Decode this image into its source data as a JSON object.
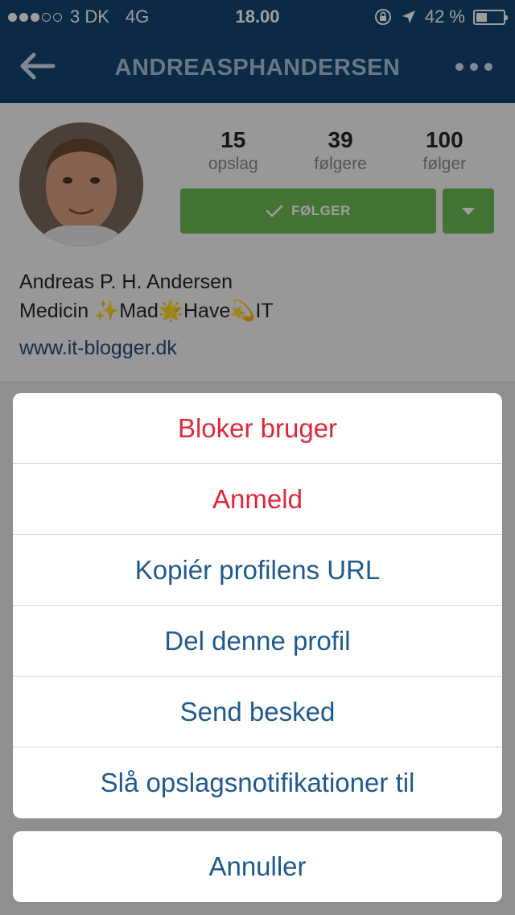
{
  "status_bar": {
    "carrier": "3 DK",
    "network": "4G",
    "time": "18.00",
    "battery": "42 %",
    "battery_level": 0.42
  },
  "nav": {
    "title": "ANDREASPHANDERSEN"
  },
  "profile": {
    "stats": [
      {
        "value": "15",
        "label": "opslag"
      },
      {
        "value": "39",
        "label": "følgere"
      },
      {
        "value": "100",
        "label": "følger"
      }
    ],
    "follow_label": "FØLGER",
    "full_name": "Andreas P. H. Andersen",
    "bio": "Medicin ✨Mad🌟Have💫IT",
    "website": "www.it-blogger.dk"
  },
  "action_sheet": {
    "items": [
      {
        "label": "Bloker bruger"
      },
      {
        "label": "Anmeld"
      },
      {
        "label": "Kopiér profilens URL"
      },
      {
        "label": "Del denne profil"
      },
      {
        "label": "Send besked"
      },
      {
        "label": "Slå opslagsnotifikationer til"
      }
    ],
    "cancel_label": "Annuller"
  },
  "colors": {
    "nav_bg": "#124572",
    "follow_green": "#6fbc54",
    "destructive": "#e0283a",
    "action_blue": "#1f5a8e"
  }
}
